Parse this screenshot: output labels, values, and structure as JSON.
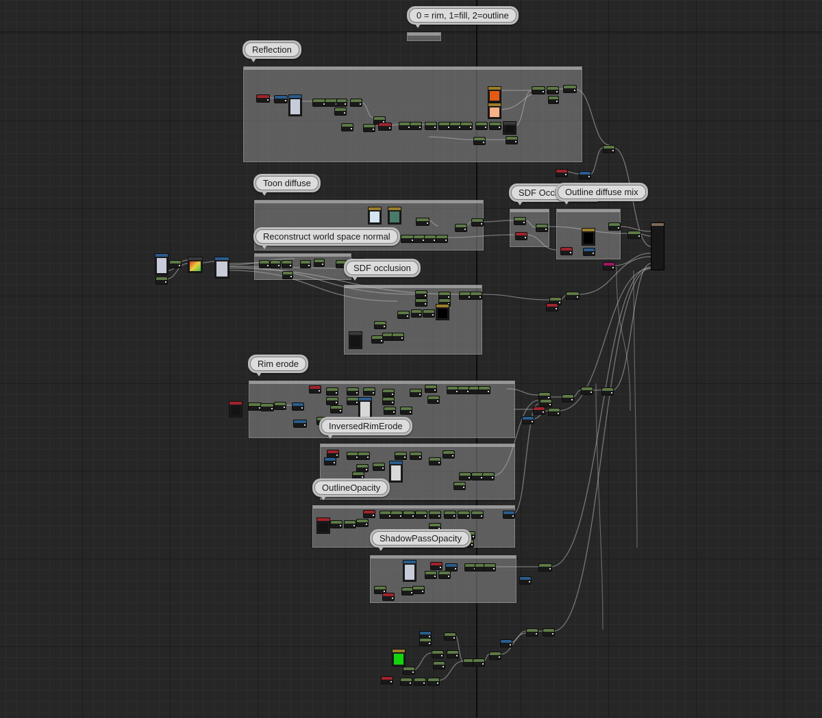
{
  "graph": {
    "comments": [
      {
        "id": "mode",
        "label": "0 = rim, 1=fill, 2=outline"
      },
      {
        "id": "reflection",
        "label": "Reflection"
      },
      {
        "id": "toon-diffuse",
        "label": "Toon diffuse"
      },
      {
        "id": "sdf-occlusion-mix",
        "label": "SDF Occlusion mix"
      },
      {
        "id": "outline-diffuse-mix",
        "label": "Outline diffuse mix"
      },
      {
        "id": "reconstruct-normal",
        "label": "Reconstruct world space normal"
      },
      {
        "id": "sdf-occlusion",
        "label": "SDF occlusion"
      },
      {
        "id": "rim-erode",
        "label": "Rim erode"
      },
      {
        "id": "inversed-rim-erode",
        "label": "InversedRimErode"
      },
      {
        "id": "outline-opacity",
        "label": "OutlineOpacity"
      },
      {
        "id": "shadow-pass-opacity",
        "label": "ShadowPassOpacity"
      }
    ]
  },
  "colors": {
    "background": "#262626",
    "node_green": "#5d7a46",
    "node_red": "#a2242c",
    "node_blue": "#2a5d8e",
    "node_magenta": "#a3165f",
    "swatch_orange": "#e35b14",
    "swatch_peach": "#f8b089",
    "swatch_green": "#12d40e",
    "swatch_light": "#c8ccd8",
    "wire": "#b9b9b9"
  }
}
